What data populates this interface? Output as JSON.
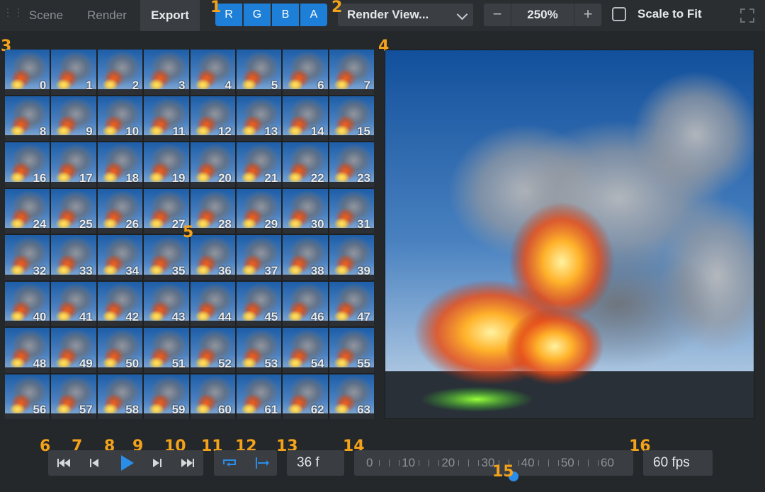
{
  "tabs": [
    {
      "label": "Scene"
    },
    {
      "label": "Render"
    },
    {
      "label": "Export"
    }
  ],
  "channels": [
    "R",
    "G",
    "B",
    "A"
  ],
  "view_dropdown": {
    "value": "Render View..."
  },
  "zoom": {
    "minus": "−",
    "value": "250%",
    "plus": "+"
  },
  "scale_to_fit": {
    "label": "Scale to Fit",
    "checked": false
  },
  "callouts": [
    "1",
    "2",
    "3",
    "4",
    "5",
    "6",
    "7",
    "8",
    "9",
    "10",
    "11",
    "12",
    "13",
    "14",
    "15",
    "16"
  ],
  "frames": [
    "0",
    "1",
    "2",
    "3",
    "4",
    "5",
    "6",
    "7",
    "8",
    "9",
    "10",
    "11",
    "12",
    "13",
    "14",
    "15",
    "16",
    "17",
    "18",
    "19",
    "20",
    "21",
    "22",
    "23",
    "24",
    "25",
    "26",
    "27",
    "28",
    "29",
    "30",
    "31",
    "32",
    "33",
    "34",
    "35",
    "36",
    "37",
    "38",
    "39",
    "40",
    "41",
    "42",
    "43",
    "44",
    "45",
    "46",
    "47",
    "48",
    "49",
    "50",
    "51",
    "52",
    "53",
    "54",
    "55",
    "56",
    "57",
    "58",
    "59",
    "60",
    "61",
    "62",
    "63"
  ],
  "current_frame": "36 f",
  "timeline": {
    "ticks": [
      "0",
      "10",
      "20",
      "30",
      "40",
      "50",
      "60"
    ],
    "position_value": 36,
    "max": 63
  },
  "fps": "60 fps",
  "colors": {
    "accent": "#1e7fd8",
    "callout": "#f4a21a",
    "background": "#25282b"
  }
}
